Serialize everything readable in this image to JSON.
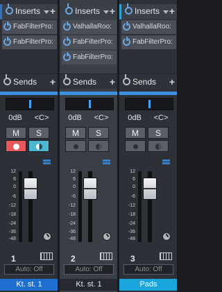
{
  "inserts_label": "Inserts",
  "sends_label": "Sends",
  "channels": [
    {
      "number": "1",
      "name": "Kt. st. 1",
      "color": "#1f6fd0",
      "inserts": [
        "FabFilterPro:",
        "FabFilterPro:"
      ],
      "volume": "0dB",
      "pan": "<C>",
      "mute": "M",
      "solo": "S",
      "record_armed": true,
      "monitor_on": true,
      "automation": "Auto: Off",
      "selected": false
    },
    {
      "number": "2",
      "name": "Kt. st. 1",
      "color": "#3a3d43",
      "inserts": [
        "ValhallaRoo:",
        "FabFilterPro:",
        "FabFilterPro:"
      ],
      "volume": "0dB",
      "pan": "<C>",
      "mute": "M",
      "solo": "S",
      "record_armed": false,
      "monitor_on": false,
      "automation": "Auto: Off",
      "selected": true
    },
    {
      "number": "3",
      "name": "Pads",
      "color": "#1aa6dc",
      "inserts": [
        "ValhallaRoo:",
        "FabFilterPro:"
      ],
      "volume": "0dB",
      "pan": "<C>",
      "mute": "M",
      "solo": "S",
      "record_armed": false,
      "monitor_on": false,
      "automation": "Auto: Off",
      "selected": false
    }
  ],
  "scale_ticks": [
    "12",
    "6",
    "0",
    "-6",
    "-12",
    "-18",
    "-24",
    "-36",
    "-48"
  ]
}
